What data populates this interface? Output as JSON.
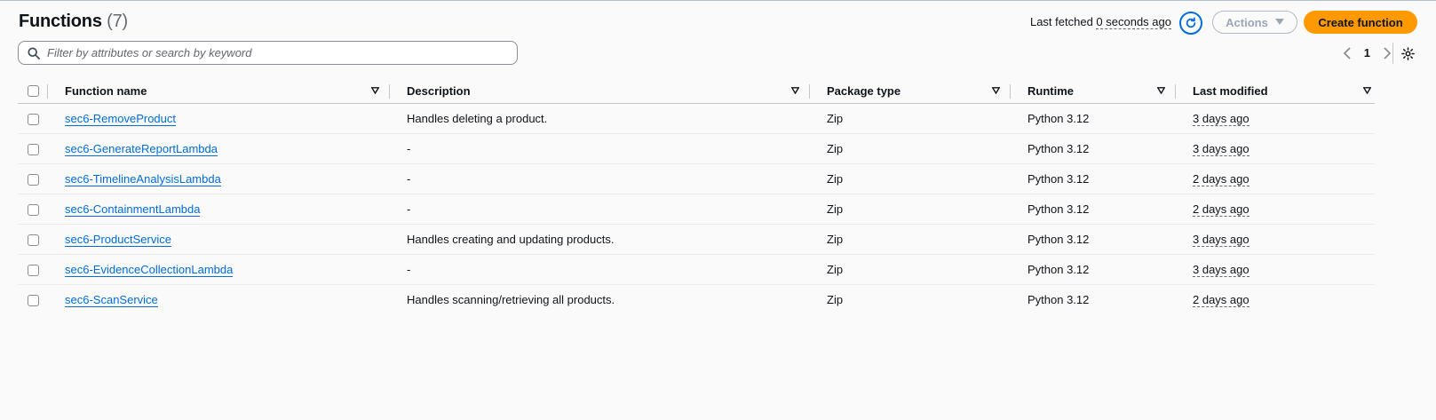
{
  "header": {
    "title": "Functions",
    "count": "(7)",
    "last_fetched_label": "Last fetched",
    "last_fetched_value": "0 seconds ago",
    "actions_label": "Actions",
    "create_label": "Create function"
  },
  "search": {
    "placeholder": "Filter by attributes or search by keyword"
  },
  "pagination": {
    "page": "1"
  },
  "table": {
    "columns": [
      "Function name",
      "Description",
      "Package type",
      "Runtime",
      "Last modified"
    ],
    "rows": [
      {
        "name": "sec6-RemoveProduct",
        "description": "Handles deleting a product.",
        "package": "Zip",
        "runtime": "Python 3.12",
        "modified": "3 days ago"
      },
      {
        "name": "sec6-GenerateReportLambda",
        "description": "-",
        "package": "Zip",
        "runtime": "Python 3.12",
        "modified": "3 days ago"
      },
      {
        "name": "sec6-TimelineAnalysisLambda",
        "description": "-",
        "package": "Zip",
        "runtime": "Python 3.12",
        "modified": "2 days ago"
      },
      {
        "name": "sec6-ContainmentLambda",
        "description": "-",
        "package": "Zip",
        "runtime": "Python 3.12",
        "modified": "2 days ago"
      },
      {
        "name": "sec6-ProductService",
        "description": "Handles creating and updating products.",
        "package": "Zip",
        "runtime": "Python 3.12",
        "modified": "3 days ago"
      },
      {
        "name": "sec6-EvidenceCollectionLambda",
        "description": "-",
        "package": "Zip",
        "runtime": "Python 3.12",
        "modified": "3 days ago"
      },
      {
        "name": "sec6-ScanService",
        "description": "Handles scanning/retrieving all products.",
        "package": "Zip",
        "runtime": "Python 3.12",
        "modified": "2 days ago"
      }
    ]
  },
  "colors": {
    "accent": "#006ce0",
    "primary_button": "#ff9900"
  },
  "icons": [
    "refresh-icon",
    "caret-down-icon",
    "search-icon",
    "chevron-left-icon",
    "chevron-right-icon",
    "settings-icon",
    "sort-icon"
  ]
}
